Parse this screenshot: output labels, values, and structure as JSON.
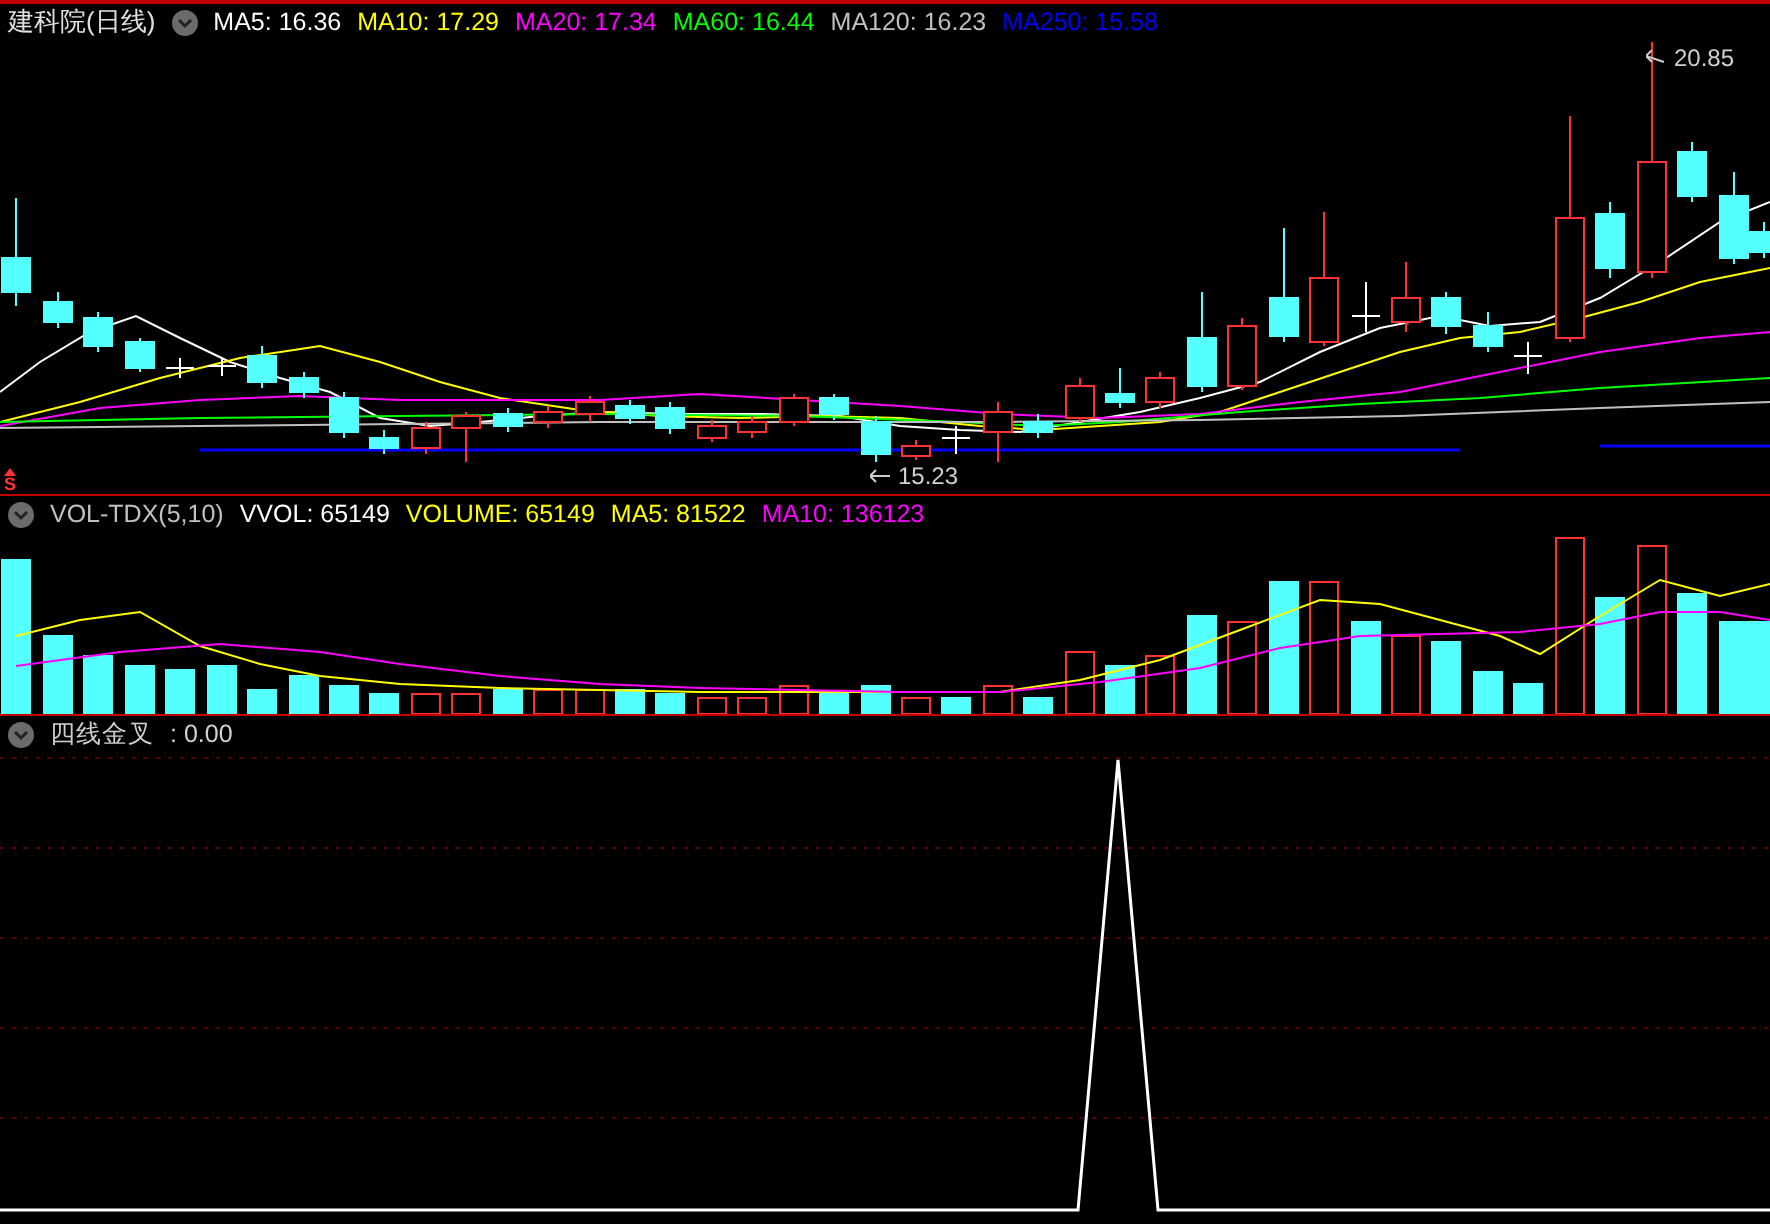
{
  "price_panel": {
    "title": "建科院(日线)",
    "indicators": [
      {
        "label": "MA5: 16.36",
        "color": "#ffffff"
      },
      {
        "label": "MA10: 17.29",
        "color": "#ffff00"
      },
      {
        "label": "MA20: 17.34",
        "color": "#ff00ff"
      },
      {
        "label": "MA60: 16.44",
        "color": "#00ff00"
      },
      {
        "label": "MA120: 16.23",
        "color": "#c0c0c0"
      },
      {
        "label": "MA250: 15.58",
        "color": "#0000ff"
      }
    ],
    "high_label": "20.85",
    "low_label": "15.23",
    "signal_marker": "S"
  },
  "volume_panel": {
    "indicators": [
      {
        "label": "VOL-TDX(5,10)",
        "color": "#c0c0c0"
      },
      {
        "label": "VVOL: 65149",
        "color": "#ffffff"
      },
      {
        "label": "VOLUME: 65149",
        "color": "#ffff00"
      },
      {
        "label": "MA5: 81522",
        "color": "#ffff00"
      },
      {
        "label": "MA10: 136123",
        "color": "#ff00ff"
      }
    ]
  },
  "indicator_panel": {
    "title": "四线金叉",
    "value": ": 0.00"
  }
}
